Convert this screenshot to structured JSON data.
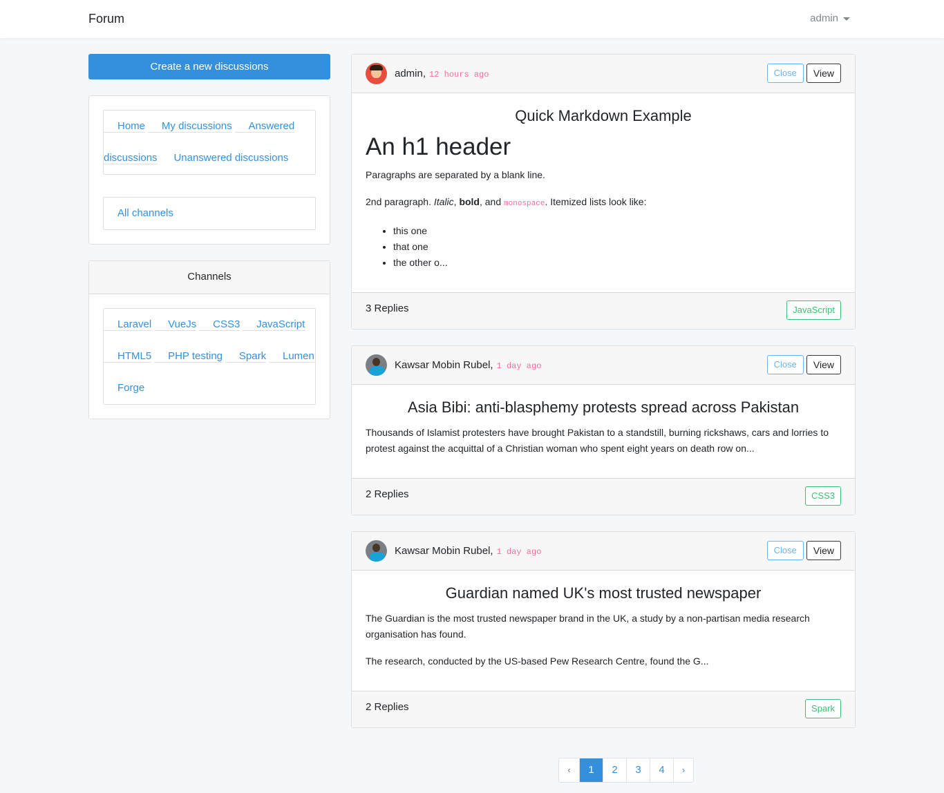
{
  "navbar": {
    "brand": "Forum",
    "user": "admin"
  },
  "sidebar": {
    "create_label": "Create a new discussions",
    "nav": [
      "Home",
      "My discussions",
      "Answered discussions",
      "Unanswered discussions"
    ],
    "all_channels": "All channels",
    "channels_title": "Channels",
    "channels": [
      "Laravel",
      "VueJs",
      "CSS3",
      "JavaScript",
      "HTML5",
      "PHP testing",
      "Spark",
      "Lumen",
      "Forge"
    ]
  },
  "posts": [
    {
      "author": "admin,",
      "time": "12 hours ago",
      "close": "Close",
      "view": "View",
      "title": "Quick Markdown Example",
      "h1": "An h1 header",
      "p1": "Paragraphs are separated by a blank line.",
      "p2_a": "2nd paragraph. ",
      "p2_italic": "Italic",
      "p2_b": ", ",
      "p2_bold": "bold",
      "p2_c": ", and ",
      "p2_code": "monospace",
      "p2_d": ". Itemized lists look like:",
      "list": [
        "this one",
        "that one",
        "the other o..."
      ],
      "replies": "3 Replies",
      "tag": "JavaScript"
    },
    {
      "author": "Kawsar Mobin Rubel,",
      "time": "1 day ago",
      "close": "Close",
      "view": "View",
      "title": "Asia Bibi: anti-blasphemy protests spread across Pakistan",
      "p1": "Thousands of Islamist protesters have brought Pakistan to a standstill, burning rickshaws, cars and lorries to protest against the acquittal of a Christian woman who spent eight years on death row on...",
      "replies": "2 Replies",
      "tag": "CSS3"
    },
    {
      "author": "Kawsar Mobin Rubel,",
      "time": "1 day ago",
      "close": "Close",
      "view": "View",
      "title": "Guardian named UK's most trusted newspaper",
      "p1": "The Guardian is the most trusted newspaper brand in the UK, a study by a non-partisan media research organisation has found.",
      "p2": "The research, conducted by the US-based Pew Research Centre, found the G...",
      "replies": "2 Replies",
      "tag": "Spark"
    }
  ],
  "pagination": {
    "prev": "‹",
    "pages": [
      "1",
      "2",
      "3",
      "4"
    ],
    "next": "›",
    "active": "1"
  }
}
